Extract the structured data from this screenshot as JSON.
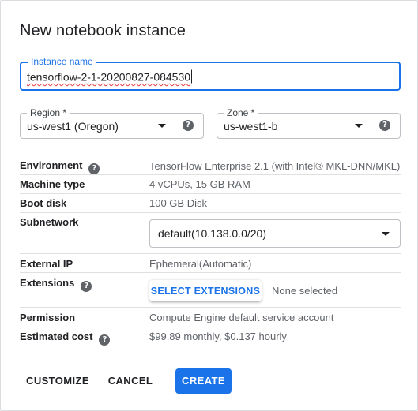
{
  "dialog": {
    "title": "New notebook instance"
  },
  "instance_name": {
    "label": "Instance name",
    "value": "tensorflow-2-1-20200827-084530"
  },
  "region": {
    "label": "Region *",
    "value": "us-west1 (Oregon)"
  },
  "zone": {
    "label": "Zone *",
    "value": "us-west1-b"
  },
  "details": {
    "environment": {
      "label": "Environment",
      "value": "TensorFlow Enterprise 2.1 (with Intel® MKL-DNN/MKL)"
    },
    "machine_type": {
      "label": "Machine type",
      "value": "4 vCPUs, 15 GB RAM"
    },
    "boot_disk": {
      "label": "Boot disk",
      "value": "100 GB Disk"
    },
    "subnetwork": {
      "label": "Subnetwork",
      "value": "default(10.138.0.0/20)"
    },
    "external_ip": {
      "label": "External IP",
      "value": "Ephemeral(Automatic)"
    },
    "extensions": {
      "label": "Extensions",
      "button_label": "SELECT EXTENSIONS",
      "status": "None selected"
    },
    "permission": {
      "label": "Permission",
      "value": "Compute Engine default service account"
    },
    "estimated_cost": {
      "label": "Estimated cost",
      "value": "$99.89 monthly, $0.137 hourly"
    }
  },
  "actions": {
    "customize_label": "CUSTOMIZE",
    "cancel_label": "CANCEL",
    "create_label": "CREATE"
  },
  "icons": {
    "help": "help-circle-icon",
    "dropdown": "dropdown-arrow-icon"
  },
  "colors": {
    "primary": "#1a73e8",
    "text": "#202124",
    "muted": "#5f6368"
  }
}
